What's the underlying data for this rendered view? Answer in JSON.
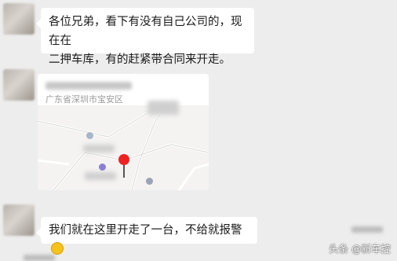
{
  "messages": [
    {
      "text": "各位兄弟，看下有没有自己公司的，现在在\n二押车库，有的赶紧带合同来开走。"
    },
    {
      "type": "location",
      "address": "广东省深圳市宝安区"
    },
    {
      "text": "我们就在这里开走了一台，不给就报警"
    }
  ],
  "watermark": "头条 @新车控"
}
